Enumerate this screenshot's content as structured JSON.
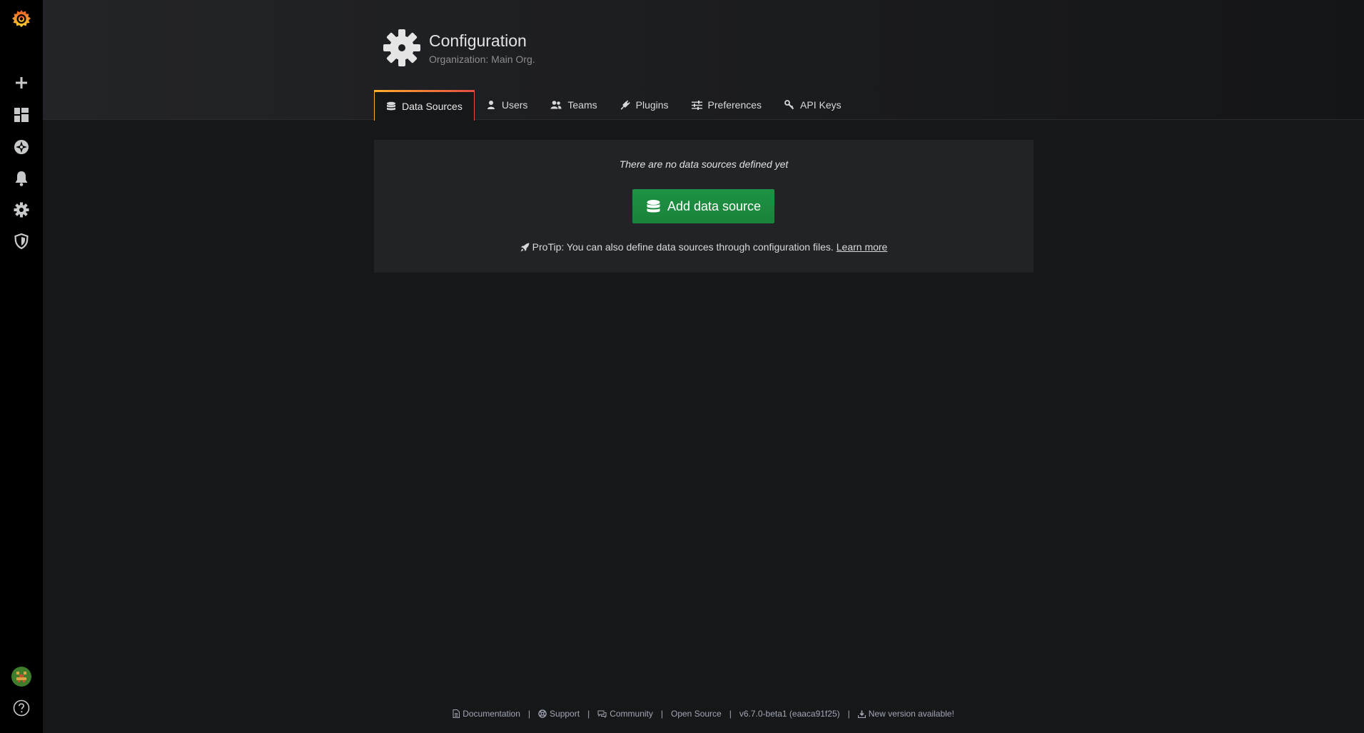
{
  "header": {
    "title": "Configuration",
    "subtitle": "Organization: Main Org."
  },
  "tabs": [
    {
      "label": "Data Sources",
      "icon": "database-icon",
      "active": true
    },
    {
      "label": "Users",
      "icon": "user-icon",
      "active": false
    },
    {
      "label": "Teams",
      "icon": "users-icon",
      "active": false
    },
    {
      "label": "Plugins",
      "icon": "plug-icon",
      "active": false
    },
    {
      "label": "Preferences",
      "icon": "sliders-icon",
      "active": false
    },
    {
      "label": "API Keys",
      "icon": "key-icon",
      "active": false
    }
  ],
  "sidemenu": {
    "items": [
      "grafana-logo",
      "create",
      "dashboards",
      "explore",
      "alerting",
      "configuration",
      "server-admin"
    ],
    "bottom": [
      "avatar",
      "help"
    ]
  },
  "empty_state": {
    "message": "There are no data sources defined yet",
    "button_label": "Add data source",
    "protip": "ProTip: You can also define data sources through configuration files.",
    "learn_more": "Learn more"
  },
  "footer": {
    "documentation": "Documentation",
    "support": "Support",
    "community": "Community",
    "open_source": "Open Source",
    "version": "v6.7.0-beta1 (eaaca91f25)",
    "new_version": "New version available!"
  },
  "colors": {
    "sidemenu_bg": "#000000",
    "page_bg": "#161719",
    "card_bg": "#212327",
    "primary_button": "#1d8a3e",
    "tab_accent_start": "#ffae2b",
    "tab_accent_end": "#e24d42"
  }
}
